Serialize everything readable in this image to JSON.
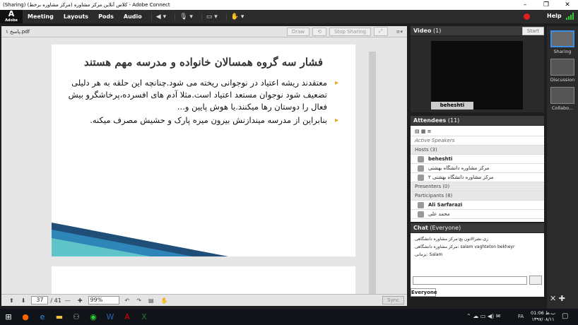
{
  "window_title": "(Sharing) کلاس آنلاین مرکز مشاوره (مرکز مشاوره برخط) - Adobe Connect",
  "logo": {
    "mark": "A",
    "label": "Adobe"
  },
  "menu": [
    "Meeting",
    "Layouts",
    "Pods",
    "Audio"
  ],
  "help": "Help",
  "share_pod": {
    "filename": "۱ پاسخ.pdf",
    "draw": "Draw",
    "stop_sharing": "Stop Sharing",
    "slide_title": "فشار سه گروه همسالان خانواده و مدرسه مهم هستند",
    "bullets": [
      "معتقدند ریشه اعتیاد در نوجوانی ریخته می شود.چنانچه این حلقه به هر دلیلی تضعیف شود نوجوان مستعد اعتیاد است.مثلا آدم های افسرده،پرخاشگرو بیش فعال را دوستان رها میکنند.یا هوش پایین و...",
      "بنابراین از مدرسه میندازنش بیرون میره پارک و حشیش مصرف میکنه."
    ],
    "page": "37",
    "total_pages": "/ 41",
    "zoom": "99%",
    "sync": "Sync"
  },
  "video_pod": {
    "title": "Video",
    "count": "(1)",
    "start": "Start",
    "name": "beheshti"
  },
  "attendees_pod": {
    "title": "Attendees",
    "count": "(11)",
    "active_speakers": "Active Speakers",
    "hosts_label": "Hosts (3)",
    "hosts": [
      "beheshti",
      "مرکز مشاوره دانشگاه بهشتی",
      "مرکز مشاوره دانشگاه بهشتی ۲"
    ],
    "presenters_label": "Presenters (0)",
    "participants_label": "Participants (8)",
    "participants": [
      "Ali Sarfarazi",
      "محمد علی"
    ]
  },
  "chat_pod": {
    "title": "Chat",
    "audience": "(Everyone)",
    "messages": [
      "زی.نشرالاتون یچ:مرکز مشاوره دانشگاهی",
      "مرکز مشاوره دانشگاهی: salam vaghteton bekheyr",
      "بزمانی: Salam"
    ],
    "tab": "Everyone"
  },
  "layouts": [
    "Sharing",
    "Discussion",
    "Collabo..."
  ],
  "clock": {
    "time": "01:06 ب.ظ",
    "date": "۱۳۹۷/۰۸/۱۱",
    "lang": "FA"
  }
}
